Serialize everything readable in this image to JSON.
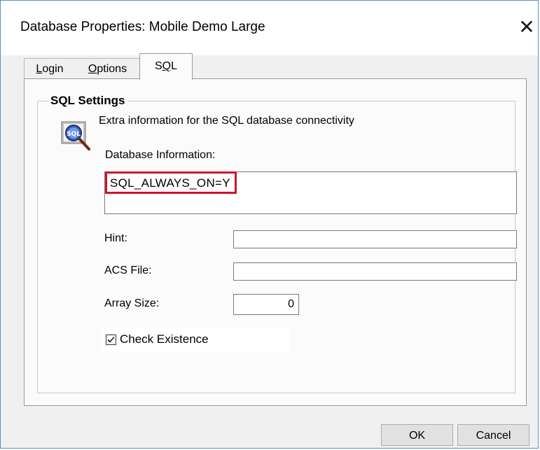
{
  "window": {
    "title": "Database Properties: Mobile Demo Large",
    "close_glyph": "✕"
  },
  "tabs": [
    {
      "label": "Login",
      "accel_index": 0,
      "active": false
    },
    {
      "label": "Options",
      "accel_index": 0,
      "active": false
    },
    {
      "label": "SQL",
      "accel_index": 1,
      "active": true
    }
  ],
  "sql_settings": {
    "group_title": "SQL Settings",
    "icon": "sql-magnifier-icon",
    "description": "Extra information for the SQL database connectivity",
    "database_information_label": "Database Information:",
    "database_information_value": "SQL_ALWAYS_ON=Y",
    "highlight_color": "#d0142c",
    "hint_label": "Hint:",
    "hint_value": "",
    "acs_file_label": "ACS File:",
    "acs_file_value": "",
    "array_size_label": "Array Size:",
    "array_size_value": "0",
    "check_existence_label": "Check Existence",
    "check_existence_checked": true
  },
  "buttons": {
    "ok_label": "OK",
    "cancel_label": "Cancel"
  }
}
